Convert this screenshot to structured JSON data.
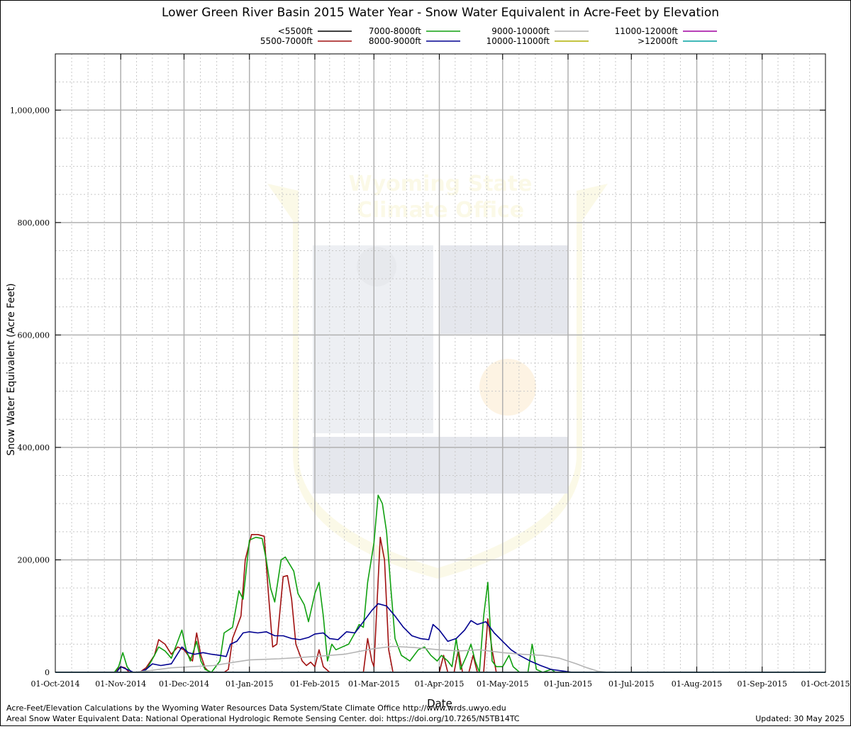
{
  "chart_data": {
    "type": "line",
    "title": "Lower Green River Basin 2015 Water Year - Snow Water Equivalent in Acre-Feet by Elevation",
    "xlabel": "Date",
    "ylabel": "Snow Water Equivalent (Acre Feet)",
    "xlim": [
      "2014-10-01",
      "2015-10-01"
    ],
    "ylim": [
      0,
      1100000
    ],
    "grid": true,
    "legend_position": "top",
    "x_ticks": [
      "01-Oct-2014",
      "01-Nov-2014",
      "01-Dec-2014",
      "01-Jan-2015",
      "01-Feb-2015",
      "01-Mar-2015",
      "01-Apr-2015",
      "01-May-2015",
      "01-Jun-2015",
      "01-Jul-2015",
      "01-Aug-2015",
      "01-Sep-2015",
      "01-Oct-2015"
    ],
    "y_ticks": [
      {
        "value": 0,
        "label": "0"
      },
      {
        "value": 200000,
        "label": "200,000"
      },
      {
        "value": 400000,
        "label": "400,000"
      },
      {
        "value": 600000,
        "label": "600,000"
      },
      {
        "value": 800000,
        "label": "800,000"
      },
      {
        "value": 1000000,
        "label": "1,000,000"
      }
    ],
    "series": [
      {
        "name": "<5500ft",
        "color": "#000000",
        "points": [
          [
            "2014-10-01",
            0
          ],
          [
            "2015-10-01",
            0
          ]
        ]
      },
      {
        "name": "5500-7000ft",
        "color": "#a01010",
        "points": [
          [
            "2014-10-01",
            0
          ],
          [
            "2014-10-29",
            0
          ],
          [
            "2014-11-01",
            10000
          ],
          [
            "2014-11-03",
            8000
          ],
          [
            "2014-11-05",
            0
          ],
          [
            "2014-11-10",
            0
          ],
          [
            "2014-11-13",
            8000
          ],
          [
            "2014-11-17",
            30000
          ],
          [
            "2014-11-19",
            58000
          ],
          [
            "2014-11-22",
            50000
          ],
          [
            "2014-11-25",
            32000
          ],
          [
            "2014-11-28",
            45000
          ],
          [
            "2014-12-01",
            40000
          ],
          [
            "2014-12-03",
            30000
          ],
          [
            "2014-12-05",
            20000
          ],
          [
            "2014-12-07",
            70000
          ],
          [
            "2014-12-09",
            30000
          ],
          [
            "2014-12-11",
            8000
          ],
          [
            "2014-12-13",
            0
          ],
          [
            "2014-12-20",
            0
          ],
          [
            "2014-12-22",
            5000
          ],
          [
            "2014-12-24",
            60000
          ],
          [
            "2014-12-26",
            80000
          ],
          [
            "2014-12-28",
            100000
          ],
          [
            "2014-12-30",
            200000
          ],
          [
            "2015-01-02",
            245000
          ],
          [
            "2015-01-05",
            245000
          ],
          [
            "2015-01-08",
            242000
          ],
          [
            "2015-01-10",
            140000
          ],
          [
            "2015-01-12",
            45000
          ],
          [
            "2015-01-14",
            50000
          ],
          [
            "2015-01-17",
            170000
          ],
          [
            "2015-01-19",
            172000
          ],
          [
            "2015-01-21",
            130000
          ],
          [
            "2015-01-23",
            50000
          ],
          [
            "2015-01-26",
            20000
          ],
          [
            "2015-01-28",
            12000
          ],
          [
            "2015-01-30",
            18000
          ],
          [
            "2015-02-01",
            10000
          ],
          [
            "2015-02-03",
            40000
          ],
          [
            "2015-02-05",
            10000
          ],
          [
            "2015-02-08",
            0
          ],
          [
            "2015-02-24",
            0
          ],
          [
            "2015-02-26",
            60000
          ],
          [
            "2015-02-28",
            20000
          ],
          [
            "2015-03-01",
            10000
          ],
          [
            "2015-03-04",
            240000
          ],
          [
            "2015-03-06",
            200000
          ],
          [
            "2015-03-08",
            40000
          ],
          [
            "2015-03-10",
            0
          ],
          [
            "2015-04-01",
            0
          ],
          [
            "2015-04-03",
            30000
          ],
          [
            "2015-04-05",
            0
          ],
          [
            "2015-04-08",
            0
          ],
          [
            "2015-04-10",
            40000
          ],
          [
            "2015-04-12",
            0
          ],
          [
            "2015-04-15",
            0
          ],
          [
            "2015-04-17",
            30000
          ],
          [
            "2015-04-19",
            0
          ],
          [
            "2015-04-22",
            0
          ],
          [
            "2015-04-24",
            95000
          ],
          [
            "2015-04-26",
            40000
          ],
          [
            "2015-04-28",
            0
          ],
          [
            "2015-10-01",
            0
          ]
        ]
      },
      {
        "name": "7000-8000ft",
        "color": "#10a010",
        "points": [
          [
            "2014-10-01",
            0
          ],
          [
            "2014-10-29",
            0
          ],
          [
            "2014-10-31",
            10000
          ],
          [
            "2014-11-02",
            35000
          ],
          [
            "2014-11-04",
            10000
          ],
          [
            "2014-11-06",
            0
          ],
          [
            "2014-11-12",
            0
          ],
          [
            "2014-11-14",
            10000
          ],
          [
            "2014-11-17",
            30000
          ],
          [
            "2014-11-19",
            45000
          ],
          [
            "2014-11-22",
            38000
          ],
          [
            "2014-11-25",
            25000
          ],
          [
            "2014-11-28",
            55000
          ],
          [
            "2014-11-30",
            75000
          ],
          [
            "2014-12-02",
            40000
          ],
          [
            "2014-12-04",
            20000
          ],
          [
            "2014-12-07",
            55000
          ],
          [
            "2014-12-09",
            20000
          ],
          [
            "2014-12-11",
            5000
          ],
          [
            "2014-12-14",
            0
          ],
          [
            "2014-12-18",
            20000
          ],
          [
            "2014-12-20",
            70000
          ],
          [
            "2014-12-24",
            80000
          ],
          [
            "2014-12-27",
            145000
          ],
          [
            "2014-12-29",
            130000
          ],
          [
            "2015-01-01",
            235000
          ],
          [
            "2015-01-04",
            240000
          ],
          [
            "2015-01-07",
            238000
          ],
          [
            "2015-01-09",
            200000
          ],
          [
            "2015-01-11",
            150000
          ],
          [
            "2015-01-13",
            125000
          ],
          [
            "2015-01-16",
            200000
          ],
          [
            "2015-01-18",
            205000
          ],
          [
            "2015-01-22",
            180000
          ],
          [
            "2015-01-24",
            140000
          ],
          [
            "2015-01-27",
            120000
          ],
          [
            "2015-01-29",
            90000
          ],
          [
            "2015-02-01",
            140000
          ],
          [
            "2015-02-03",
            160000
          ],
          [
            "2015-02-05",
            100000
          ],
          [
            "2015-02-07",
            20000
          ],
          [
            "2015-02-09",
            50000
          ],
          [
            "2015-02-11",
            40000
          ],
          [
            "2015-02-14",
            45000
          ],
          [
            "2015-02-17",
            50000
          ],
          [
            "2015-02-20",
            70000
          ],
          [
            "2015-02-22",
            85000
          ],
          [
            "2015-02-24",
            80000
          ],
          [
            "2015-02-26",
            160000
          ],
          [
            "2015-03-01",
            230000
          ],
          [
            "2015-03-03",
            315000
          ],
          [
            "2015-03-05",
            300000
          ],
          [
            "2015-03-07",
            250000
          ],
          [
            "2015-03-09",
            150000
          ],
          [
            "2015-03-11",
            60000
          ],
          [
            "2015-03-14",
            30000
          ],
          [
            "2015-03-18",
            20000
          ],
          [
            "2015-03-22",
            40000
          ],
          [
            "2015-03-25",
            45000
          ],
          [
            "2015-03-28",
            30000
          ],
          [
            "2015-03-31",
            20000
          ],
          [
            "2015-04-02",
            30000
          ],
          [
            "2015-04-05",
            20000
          ],
          [
            "2015-04-07",
            10000
          ],
          [
            "2015-04-09",
            60000
          ],
          [
            "2015-04-11",
            5000
          ],
          [
            "2015-04-14",
            30000
          ],
          [
            "2015-04-16",
            50000
          ],
          [
            "2015-04-18",
            20000
          ],
          [
            "2015-04-20",
            0
          ],
          [
            "2015-04-22",
            100000
          ],
          [
            "2015-04-24",
            160000
          ],
          [
            "2015-04-26",
            20000
          ],
          [
            "2015-04-28",
            10000
          ],
          [
            "2015-05-01",
            10000
          ],
          [
            "2015-05-04",
            30000
          ],
          [
            "2015-05-06",
            10000
          ],
          [
            "2015-05-09",
            0
          ],
          [
            "2015-05-13",
            0
          ],
          [
            "2015-05-15",
            50000
          ],
          [
            "2015-05-17",
            5000
          ],
          [
            "2015-05-20",
            0
          ],
          [
            "2015-05-24",
            5000
          ],
          [
            "2015-05-26",
            0
          ],
          [
            "2015-10-01",
            0
          ]
        ]
      },
      {
        "name": "8000-9000ft",
        "color": "#000090",
        "points": [
          [
            "2014-10-01",
            0
          ],
          [
            "2014-10-30",
            0
          ],
          [
            "2014-11-01",
            10000
          ],
          [
            "2014-11-04",
            5000
          ],
          [
            "2014-11-07",
            0
          ],
          [
            "2014-11-10",
            0
          ],
          [
            "2014-11-13",
            5000
          ],
          [
            "2014-11-16",
            15000
          ],
          [
            "2014-11-20",
            12000
          ],
          [
            "2014-11-25",
            15000
          ],
          [
            "2014-11-30",
            45000
          ],
          [
            "2014-12-03",
            35000
          ],
          [
            "2014-12-06",
            32000
          ],
          [
            "2014-12-10",
            35000
          ],
          [
            "2014-12-14",
            32000
          ],
          [
            "2014-12-18",
            30000
          ],
          [
            "2014-12-21",
            28000
          ],
          [
            "2014-12-23",
            50000
          ],
          [
            "2014-12-26",
            55000
          ],
          [
            "2014-12-29",
            70000
          ],
          [
            "2015-01-01",
            72000
          ],
          [
            "2015-01-05",
            70000
          ],
          [
            "2015-01-09",
            72000
          ],
          [
            "2015-01-13",
            65000
          ],
          [
            "2015-01-17",
            65000
          ],
          [
            "2015-01-21",
            60000
          ],
          [
            "2015-01-25",
            58000
          ],
          [
            "2015-01-29",
            62000
          ],
          [
            "2015-02-01",
            68000
          ],
          [
            "2015-02-05",
            70000
          ],
          [
            "2015-02-08",
            60000
          ],
          [
            "2015-02-12",
            58000
          ],
          [
            "2015-02-16",
            72000
          ],
          [
            "2015-02-20",
            70000
          ],
          [
            "2015-02-24",
            90000
          ],
          [
            "2015-02-28",
            110000
          ],
          [
            "2015-03-03",
            122000
          ],
          [
            "2015-03-07",
            118000
          ],
          [
            "2015-03-11",
            100000
          ],
          [
            "2015-03-15",
            80000
          ],
          [
            "2015-03-19",
            65000
          ],
          [
            "2015-03-23",
            60000
          ],
          [
            "2015-03-27",
            58000
          ],
          [
            "2015-03-29",
            85000
          ],
          [
            "2015-04-01",
            75000
          ],
          [
            "2015-04-05",
            55000
          ],
          [
            "2015-04-09",
            60000
          ],
          [
            "2015-04-13",
            75000
          ],
          [
            "2015-04-16",
            92000
          ],
          [
            "2015-04-19",
            85000
          ],
          [
            "2015-04-23",
            90000
          ],
          [
            "2015-04-27",
            70000
          ],
          [
            "2015-05-01",
            55000
          ],
          [
            "2015-05-05",
            40000
          ],
          [
            "2015-05-09",
            30000
          ],
          [
            "2015-05-14",
            20000
          ],
          [
            "2015-05-19",
            12000
          ],
          [
            "2015-05-24",
            5000
          ],
          [
            "2015-05-30",
            2000
          ],
          [
            "2015-06-03",
            0
          ],
          [
            "2015-10-01",
            0
          ]
        ]
      },
      {
        "name": "9000-10000ft",
        "color": "#b4b4b4",
        "points": [
          [
            "2014-10-01",
            0
          ],
          [
            "2014-11-07",
            0
          ],
          [
            "2014-11-15",
            3000
          ],
          [
            "2014-11-25",
            8000
          ],
          [
            "2014-12-05",
            10000
          ],
          [
            "2014-12-15",
            12000
          ],
          [
            "2014-12-25",
            18000
          ],
          [
            "2015-01-01",
            22000
          ],
          [
            "2015-01-15",
            24000
          ],
          [
            "2015-02-01",
            28000
          ],
          [
            "2015-02-15",
            32000
          ],
          [
            "2015-03-01",
            42000
          ],
          [
            "2015-03-10",
            46000
          ],
          [
            "2015-03-20",
            44000
          ],
          [
            "2015-04-01",
            40000
          ],
          [
            "2015-04-10",
            38000
          ],
          [
            "2015-04-20",
            40000
          ],
          [
            "2015-05-01",
            35000
          ],
          [
            "2015-05-10",
            32000
          ],
          [
            "2015-05-20",
            30000
          ],
          [
            "2015-05-28",
            25000
          ],
          [
            "2015-06-05",
            15000
          ],
          [
            "2015-06-10",
            8000
          ],
          [
            "2015-06-15",
            2000
          ],
          [
            "2015-06-20",
            0
          ],
          [
            "2015-10-01",
            0
          ]
        ]
      },
      {
        "name": "10000-11000ft",
        "color": "#b0b000",
        "points": [
          [
            "2014-10-01",
            0
          ],
          [
            "2015-10-01",
            0
          ]
        ]
      },
      {
        "name": "11000-12000ft",
        "color": "#a000a0",
        "points": [
          [
            "2014-10-01",
            0
          ],
          [
            "2015-10-01",
            0
          ]
        ]
      },
      {
        "name": ">12000ft",
        "color": "#00a0a0",
        "points": [
          [
            "2014-10-01",
            0
          ],
          [
            "2015-10-01",
            0
          ]
        ]
      }
    ]
  },
  "footer": {
    "line1": "Acre-Feet/Elevation Calculations by the Wyoming Water Resources Data System/State Climate Office http://www.wrds.uwyo.edu",
    "line2": "Areal Snow Water Equivalent Data: National Operational Hydrologic Remote Sensing Center. doi: https://doi.org/10.7265/N5TB14TC",
    "updated": "Updated: 30 May 2025"
  },
  "watermark": {
    "text_line1": "Wyoming State",
    "text_line2": "Climate Office"
  }
}
